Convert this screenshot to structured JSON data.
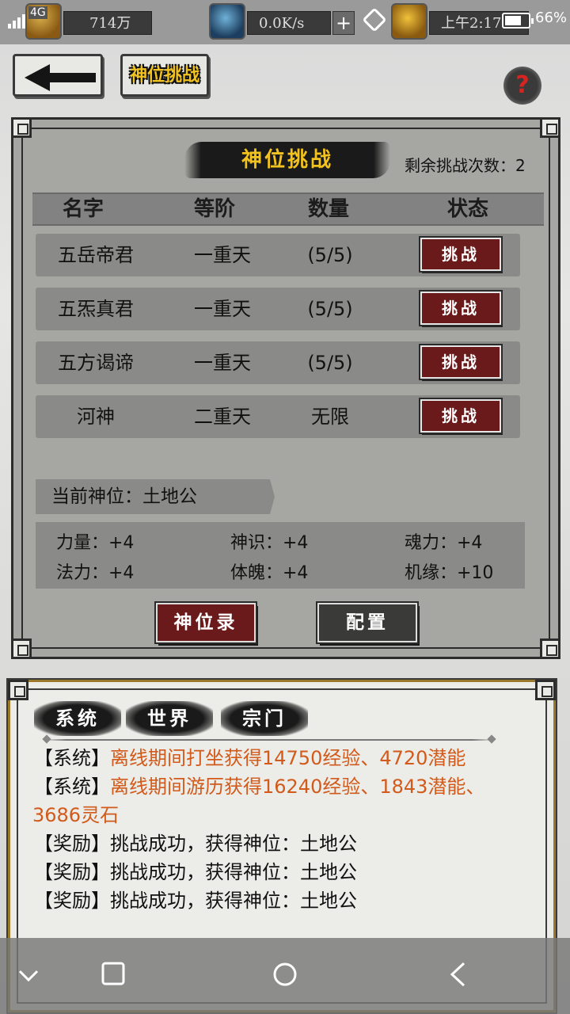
{
  "status_bar": {
    "network": "4G",
    "resource1_value": "714万",
    "resource2_value": "0.0K/s",
    "time": "上午2:17",
    "battery": "66%"
  },
  "top": {
    "back_icon": "arrow-left-icon",
    "title_button": "神位挑战",
    "help_label": "?"
  },
  "panel": {
    "title": "神位挑战",
    "remaining_label": "剩余挑战次数：2",
    "headers": [
      "名字",
      "等阶",
      "数量",
      "状态"
    ],
    "rows": [
      {
        "name": "五岳帝君",
        "rank": "一重天",
        "count": "(5/5)",
        "action": "挑战"
      },
      {
        "name": "五炁真君",
        "rank": "一重天",
        "count": "(5/5)",
        "action": "挑战"
      },
      {
        "name": "五方谒谛",
        "rank": "一重天",
        "count": "(5/5)",
        "action": "挑战"
      },
      {
        "name": "河神",
        "rank": "二重天",
        "count": "无限",
        "action": "挑战"
      }
    ],
    "current_position": "当前神位：土地公",
    "stats": [
      "力量：+4",
      "神识：+4",
      "魂力：+4",
      "法力：+4",
      "体魄：+4",
      "机缘：+10"
    ],
    "record_button": "神位录",
    "config_button": "配置"
  },
  "log": {
    "tabs": [
      "系统",
      "世界",
      "宗门"
    ],
    "lines": [
      {
        "prefix": "【系统】",
        "text": "离线期间打坐获得14750经验、4720潜能",
        "highlight": true
      },
      {
        "prefix": "【系统】",
        "text": "离线期间游历获得16240经验、1843潜能、",
        "highlight": true
      },
      {
        "prefix": "",
        "text": "3686灵石",
        "highlight": true
      },
      {
        "prefix": "【奖励】",
        "text": "挑战成功，获得神位：土地公",
        "highlight": false
      },
      {
        "prefix": "【奖励】",
        "text": "挑战成功，获得神位：土地公",
        "highlight": false
      },
      {
        "prefix": "【奖励】",
        "text": "挑战成功，获得神位：土地公",
        "highlight": false
      }
    ]
  },
  "navbar": {
    "icons": [
      "chevron-down-icon",
      "square-icon",
      "circle-icon",
      "back-triangle-icon"
    ]
  },
  "colors": {
    "accent_gold": "#f2c21e",
    "button_red": "#6a1a1a",
    "log_highlight": "#d25a1a"
  }
}
